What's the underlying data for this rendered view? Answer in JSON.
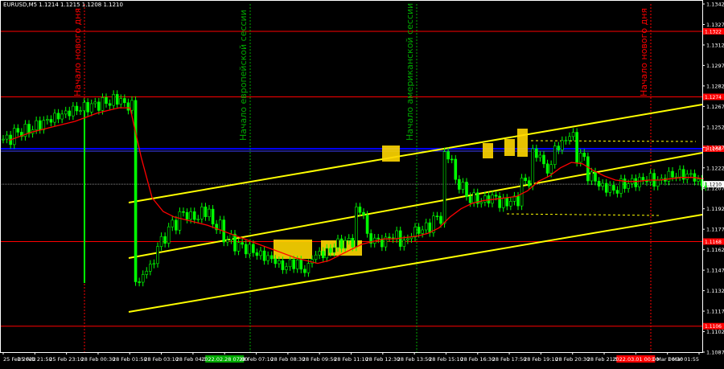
{
  "chart_title": "EURUSD,M5  1.1214 1.1215 1.1208 1.1210",
  "colors": {
    "background": "#000000",
    "candle": "#00ff00",
    "ma": "#ff0000",
    "channel": "#ffff00",
    "level": "#ff0000",
    "blue_level": "#0000ff",
    "session_line": "#00aa00",
    "day_line": "#ff0000",
    "axis_text": "#ffffff",
    "badge_bg": "#ff0000",
    "badge_green": "#00aa00",
    "highlight": "#ffd700"
  },
  "price_axis": {
    "min": 1.1087,
    "max": 1.1342,
    "ticks": [
      "1.1342",
      "1.1327",
      "1.1312",
      "1.1297",
      "1.1282",
      "1.1267",
      "1.1252",
      "1.1237",
      "1.1222",
      "1.1207",
      "1.1192",
      "1.1177",
      "1.1162",
      "1.1147",
      "1.1132",
      "1.1117",
      "1.1102",
      "1.1087"
    ],
    "tick_values": [
      1.1342,
      1.1327,
      1.1312,
      1.1297,
      1.1282,
      1.1267,
      1.1252,
      1.1237,
      1.1222,
      1.1207,
      1.1192,
      1.1177,
      1.1162,
      1.1147,
      1.1132,
      1.1117,
      1.1102,
      1.1087
    ]
  },
  "time_axis": {
    "labels": [
      "25 Feb 2022",
      "25 Feb 21:50",
      "25 Feb 23:10",
      "28 Feb 00:30",
      "28 Feb 01:50",
      "28 Feb 03:10",
      "28 Feb 04:30",
      "2022.02.28 07:00",
      "28 Feb 07:10",
      "28 Feb 08:30",
      "28 Feb 09:50",
      "28 Feb 11:10",
      "28 Feb 12:30",
      "28 Feb 13:50",
      "28 Feb 15:10",
      "28 Feb 16:30",
      "28 Feb 17:50",
      "28 Feb 19:10",
      "28 Feb 20:30",
      "28 Feb 21:50",
      "2022.03.01 00:00",
      "1 Mar 00:30",
      "1 Mar 01:55"
    ]
  },
  "levels": [
    {
      "price": 1.1322,
      "label": "1.1322",
      "kind": "red"
    },
    {
      "price": 1.1274,
      "label": "1.1274",
      "kind": "red"
    },
    {
      "price": 1.1236,
      "label": "1.1236",
      "kind": "blue"
    },
    {
      "price": 1.1168,
      "label": "1.1168",
      "kind": "red"
    },
    {
      "price": 1.1106,
      "label": "1.1106",
      "kind": "red"
    },
    {
      "price": 1.121,
      "label": "1.1210",
      "kind": "current"
    }
  ],
  "vertical_labels": [
    {
      "text": "Начало нового дня",
      "kind": "day"
    },
    {
      "text": "Начало европейской сессии",
      "kind": "session"
    },
    {
      "text": "Начало американской сессии",
      "kind": "session"
    },
    {
      "text": "Начало нового дня",
      "kind": "day"
    }
  ],
  "series": {
    "price": [
      1.1243,
      1.1248,
      1.125,
      1.1254,
      1.1258,
      1.1261,
      1.1264,
      1.1266,
      1.1268,
      1.127,
      1.1272,
      1.1268,
      1.114,
      1.115,
      1.1168,
      1.118,
      1.1188,
      1.1186,
      1.119,
      1.118,
      1.117,
      1.1165,
      1.1162,
      1.1158,
      1.1155,
      1.115,
      1.1152,
      1.1148,
      1.1158,
      1.116,
      1.1166,
      1.1168,
      1.119,
      1.117,
      1.1168,
      1.1172,
      1.1168,
      1.1175,
      1.1178,
      1.1185,
      1.123,
      1.121,
      1.12,
      1.1198,
      1.12,
      1.1196,
      1.1198,
      1.1212,
      1.1232,
      1.1222,
      1.1238,
      1.1245,
      1.123,
      1.1215,
      1.1208,
      1.1206,
      1.121,
      1.1212,
      1.1214,
      1.1212,
      1.1216,
      1.1217,
      1.1216,
      1.121
    ],
    "ma": [
      1.1242,
      1.1245,
      1.1248,
      1.125,
      1.1252,
      1.1254,
      1.1256,
      1.1259,
      1.1262,
      1.1264,
      1.1266,
      1.1266,
      1.123,
      1.12,
      1.119,
      1.1186,
      1.1184,
      1.1182,
      1.118,
      1.1177,
      1.1174,
      1.1171,
      1.1168,
      1.1165,
      1.1162,
      1.1159,
      1.1156,
      1.1154,
      1.1152,
      1.1154,
      1.1158,
      1.1162,
      1.1166,
      1.1168,
      1.117,
      1.117,
      1.1171,
      1.1172,
      1.1174,
      1.1178,
      1.1186,
      1.1192,
      1.1196,
      1.1198,
      1.1199,
      1.12,
      1.1201,
      1.1205,
      1.1212,
      1.1216,
      1.1222,
      1.1226,
      1.1225,
      1.122,
      1.1216,
      1.1213,
      1.1212,
      1.1212,
      1.1213,
      1.1213,
      1.1214,
      1.1215,
      1.1215,
      1.1214
    ]
  }
}
